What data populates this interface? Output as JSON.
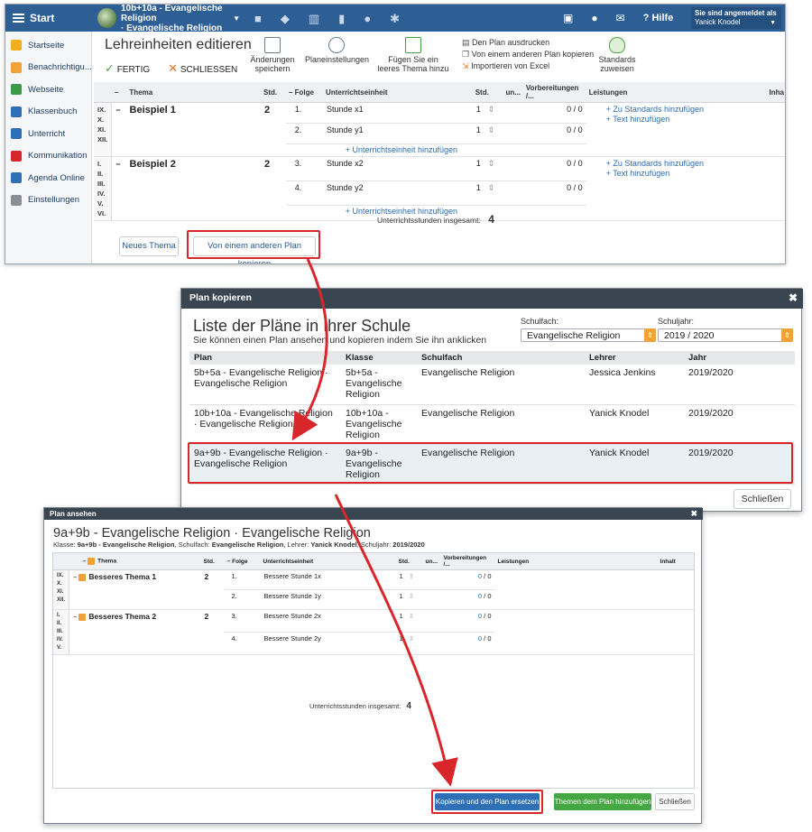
{
  "topbar": {
    "start_label": "Start",
    "class_title_line1": "10b+10a - Evangelische Religion",
    "class_title_line2": "· Evangelische Religion",
    "hilfe_label": "Hilfe",
    "logged_in_label": "Sie sind angemeldet als",
    "user_name": "Yanick Knodel"
  },
  "sidebar": {
    "items": [
      {
        "label": "Startseite",
        "icon": "star-icon",
        "color": "#f2b01e"
      },
      {
        "label": "Benachrichtigu...",
        "icon": "envelope-icon",
        "color": "#f0a237"
      },
      {
        "label": "Webseite",
        "icon": "home-icon",
        "color": "#3a9a47"
      },
      {
        "label": "Klassenbuch",
        "icon": "book-icon",
        "color": "#2e6fb5"
      },
      {
        "label": "Unterricht",
        "icon": "briefcase-icon",
        "color": "#2e6fb5"
      },
      {
        "label": "Kommunikation",
        "icon": "chat-icon",
        "color": "#d9262b"
      },
      {
        "label": "Agenda Online",
        "icon": "pen-icon",
        "color": "#2e6fb5"
      },
      {
        "label": "Einstellungen",
        "icon": "gear-icon",
        "color": "#8a8f95"
      }
    ]
  },
  "editor": {
    "title": "Lehreinheiten editieren",
    "fertig_label": "FERTIG",
    "schliessen_label": "SCHLIESSEN",
    "save_label": "Änderungen speichern",
    "settings_label": "Planeinstellungen",
    "add_topic_label": "Fügen Sie ein leeres Thema hinzu",
    "print_label": "Den Plan ausdrucken",
    "copy_other_label": "Von einem anderen Plan kopieren",
    "import_label": "Importieren von Excel",
    "standards_label": "Standards zuweisen",
    "columns": {
      "thema": "Thema",
      "std": "Std.",
      "folge": "Folge",
      "unit": "Unterrichtseinheit",
      "std2": "Std.",
      "un": "un...",
      "prep": "Vorbereitungen /...",
      "leistungen": "Leistungen",
      "inhalt": "Inha"
    },
    "rows": [
      {
        "roman": "IX. X. XI. XII.",
        "topic": "Beispiel 1",
        "std": "2",
        "units": [
          {
            "folge": "1.",
            "name": "Stunde x1",
            "std": "1",
            "prep": "0 / 0"
          },
          {
            "folge": "2.",
            "name": "Stunde y1",
            "std": "1",
            "prep": "0 / 0"
          }
        ],
        "add_unit": "+ Unterrichtseinheit hinzufügen",
        "add_standards": "+ Zu Standards hinzufügen",
        "add_text": "+ Text hinzufügen"
      },
      {
        "roman": "I. II. III. IV. V. VI.",
        "topic": "Beispiel 2",
        "std": "2",
        "units": [
          {
            "folge": "3.",
            "name": "Stunde x2",
            "std": "1",
            "prep": "0 / 0"
          },
          {
            "folge": "4.",
            "name": "Stunde y2",
            "std": "1",
            "prep": "0 / 0"
          }
        ],
        "add_unit": "+ Unterrichtseinheit hinzufügen",
        "add_standards": "+ Zu Standards hinzufügen",
        "add_text": "+ Text hinzufügen"
      }
    ],
    "total_label": "Unterrichtsstunden insgesamt:",
    "total_value": "4",
    "new_topic_button": "Neues Thema",
    "copy_button": "Von einem anderen Plan kopieren"
  },
  "plan_kopieren": {
    "header": "Plan kopieren",
    "title": "Liste der Pläne in Ihrer Schule",
    "subtitle": "Sie können einen Plan ansehen und kopieren indem Sie ihn anklicken",
    "schulfach_label": "Schulfach:",
    "schulfach_value": "Evangelische Religion",
    "schuljahr_label": "Schuljahr:",
    "schuljahr_value": "2019 / 2020",
    "columns": [
      "Plan",
      "Klasse",
      "Schulfach",
      "Lehrer",
      "Jahr"
    ],
    "rows": [
      {
        "plan": "5b+5a - Evangelische Religion · Evangelische Religion",
        "klasse": "5b+5a - Evangelische Religion",
        "fach": "Evangelische Religion",
        "lehrer": "Jessica Jenkins",
        "jahr": "2019/2020"
      },
      {
        "plan": "10b+10a - Evangelische Religion · Evangelische Religion",
        "klasse": "10b+10a - Evangelische Religion",
        "fach": "Evangelische Religion",
        "lehrer": "Yanick Knodel",
        "jahr": "2019/2020"
      },
      {
        "plan": "9a+9b - Evangelische Religion · Evangelische Religion",
        "klasse": "9a+9b - Evangelische Religion",
        "fach": "Evangelische Religion",
        "lehrer": "Yanick Knodel",
        "jahr": "2019/2020"
      }
    ],
    "close_button": "Schließen"
  },
  "plan_ansehen": {
    "header": "Plan ansehen",
    "title": "9a+9b - Evangelische Religion · Evangelische Religion",
    "meta_klasse_label": "Klasse:",
    "meta_klasse": "9a+9b - Evangelische Religion",
    "meta_fach_label": "Schulfach:",
    "meta_fach": "Evangelische Religion",
    "meta_lehrer_label": "Lehrer:",
    "meta_lehrer": "Yanick Knodel",
    "meta_jahr_label": "Schuljahr:",
    "meta_jahr": "2019/2020",
    "columns": {
      "thema": "Thema",
      "std": "Std.",
      "folge": "Folge",
      "unit": "Unterrichtseinheit",
      "std2": "Std.",
      "un": "un...",
      "prep": "Vorbereitungen /...",
      "leistungen": "Leistungen",
      "inhalt": "Inhalt"
    },
    "rows": [
      {
        "roman": "IX. X. XI. XII.",
        "topic": "Besseres Thema 1",
        "std": "2",
        "units": [
          {
            "folge": "1.",
            "name": "Bessere Stunde 1x",
            "std": "1",
            "prep_a": "0",
            "prep_b": "/ 0"
          },
          {
            "folge": "2.",
            "name": "Bessere Stunde 1y",
            "std": "1",
            "prep_a": "0",
            "prep_b": "/ 0"
          }
        ]
      },
      {
        "roman": "I. II. III. IV. V.",
        "topic": "Besseres Thema 2",
        "std": "2",
        "units": [
          {
            "folge": "3.",
            "name": "Bessere Stunde 2x",
            "std": "1",
            "prep_a": "0",
            "prep_b": "/ 0"
          },
          {
            "folge": "4.",
            "name": "Bessere Stunde 2y",
            "std": "1",
            "prep_a": "0",
            "prep_b": "/ 0"
          }
        ]
      }
    ],
    "total_label": "Unterrichtsstunden insgesamt:",
    "total_value": "4",
    "copy_replace_button": "Kopieren und den Plan ersetzen",
    "add_topics_button": "Themen dem Plan hinzufügen",
    "close_button": "Schließen"
  },
  "colors": {
    "topbar": "#2d5f95",
    "accent_red": "#d9262b",
    "orange": "#f0a237",
    "green_button": "#45a644",
    "blue_button": "#2e6fb5"
  }
}
